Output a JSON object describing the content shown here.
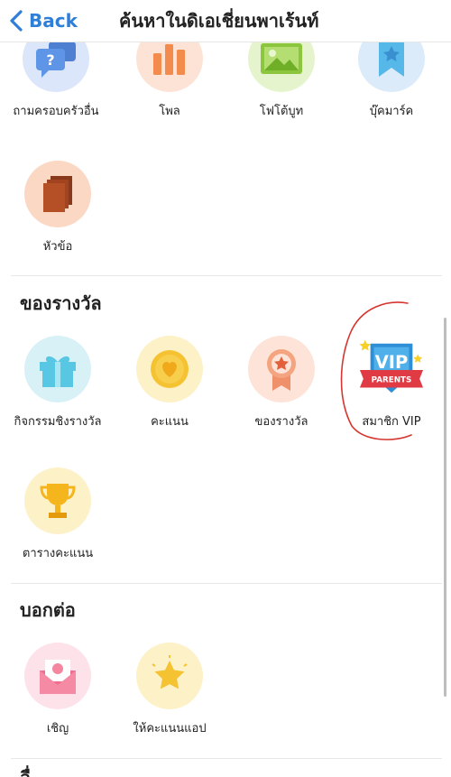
{
  "nav": {
    "back_label": "Back",
    "title": "ค้นหาในดิเอเชี่ยนพาเร้นท์"
  },
  "row1": [
    {
      "label": "ถามครอบครัวอื่น",
      "icon": "question-chat-icon",
      "bg": "#dbe6fb"
    },
    {
      "label": "โพล",
      "icon": "bar-chart-icon",
      "bg": "#fde3d6"
    },
    {
      "label": "โฟโต้บูท",
      "icon": "photo-icon",
      "bg": "#e5f4cc"
    },
    {
      "label": "บุ๊คมาร์ค",
      "icon": "bookmark-icon",
      "bg": "#dcebfa"
    }
  ],
  "row2": [
    {
      "label": "หัวข้อ",
      "icon": "topics-icon",
      "bg": "#fbd8c4"
    }
  ],
  "rewards": {
    "title": "ของรางวัล",
    "items": [
      {
        "label": "กิจกรรมชิงรางวัล",
        "icon": "gift-icon",
        "bg": "#d8f1f7"
      },
      {
        "label": "คะแนน",
        "icon": "coin-heart-icon",
        "bg": "#fdf1c8"
      },
      {
        "label": "ของรางวัล",
        "icon": "award-ribbon-icon",
        "bg": "#fde3d8"
      },
      {
        "label": "สมาชิก VIP",
        "icon": "vip-parents-badge-icon",
        "bg": "#ffffff"
      }
    ],
    "row2": [
      {
        "label": "ตารางคะแนน",
        "icon": "trophy-icon",
        "bg": "#fdf1c8"
      }
    ]
  },
  "vip_badge": {
    "top": "VIP",
    "ribbon": "PARENTS"
  },
  "share": {
    "title": "บอกต่อ",
    "items": [
      {
        "label": "เชิญ",
        "icon": "invite-envelope-icon",
        "bg": "#fde2ea"
      },
      {
        "label": "ให้คะแนนแอป",
        "icon": "star-rating-icon",
        "bg": "#fdf1c8"
      }
    ]
  },
  "partial_section_title": "อื่"
}
